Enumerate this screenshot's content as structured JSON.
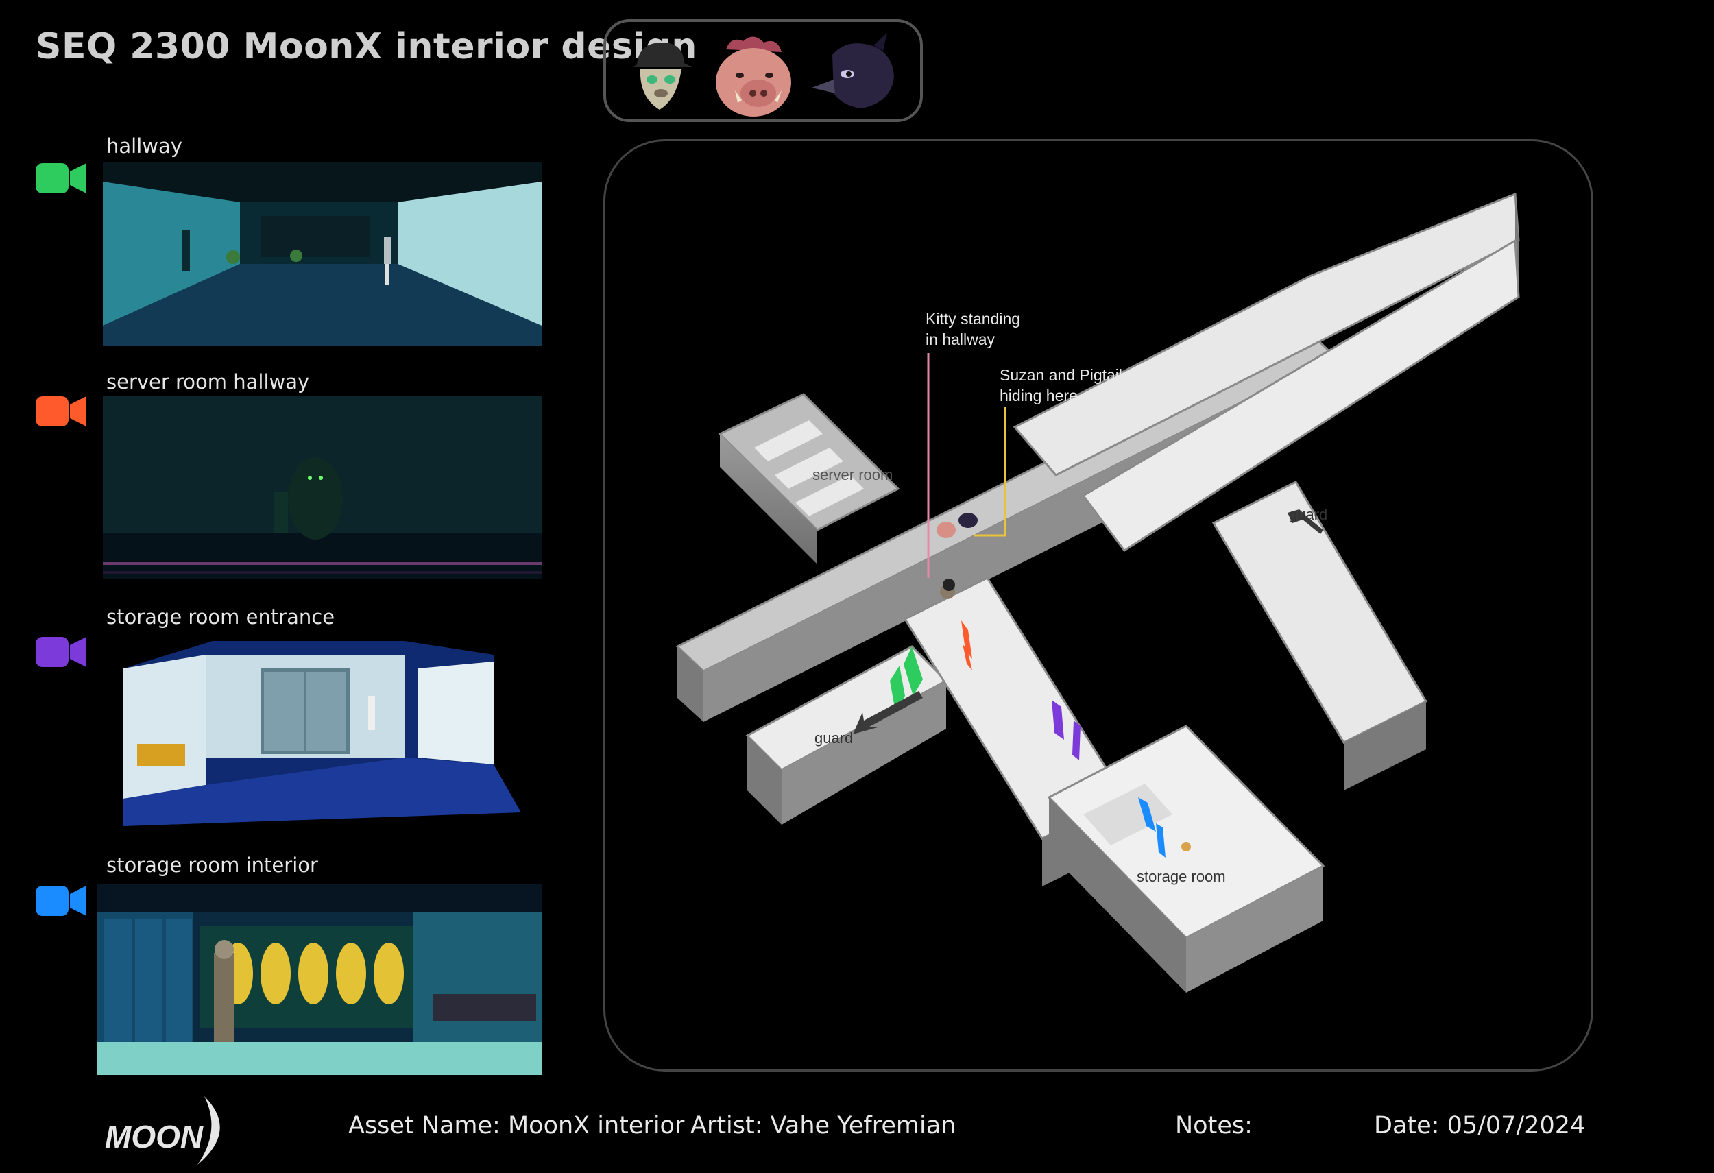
{
  "title": "SEQ 2300 MoonX interior design",
  "characters": [
    {
      "icon": "cat-in-cap-icon"
    },
    {
      "icon": "boar-icon"
    },
    {
      "icon": "crow-icon"
    }
  ],
  "shots": [
    {
      "label": "hallway",
      "color": "#2ecc5f"
    },
    {
      "label": "server room hallway",
      "color": "#ff5a2c"
    },
    {
      "label": "storage room entrance",
      "color": "#7b3ad9"
    },
    {
      "label": "storage room interior",
      "color": "#1a8cff"
    }
  ],
  "map": {
    "annotations": {
      "kitty": [
        "Kitty standing",
        "in hallway"
      ],
      "suzan": [
        "Suzan and Pigtail",
        "hiding here"
      ]
    },
    "labels": {
      "server_room": "server room",
      "storage_room": "storage room",
      "guard_right": "guard",
      "guard_left": "guard"
    },
    "colors": {
      "kitty_line": "#e48aa8",
      "suzan_line": "#e9c33c"
    }
  },
  "footer": {
    "logo_text": "MOON",
    "asset_name": "Asset Name: MoonX interior",
    "artist": "Artist: Vahe Yefremian",
    "notes": "Notes:",
    "date": "Date: 05/07/2024"
  }
}
